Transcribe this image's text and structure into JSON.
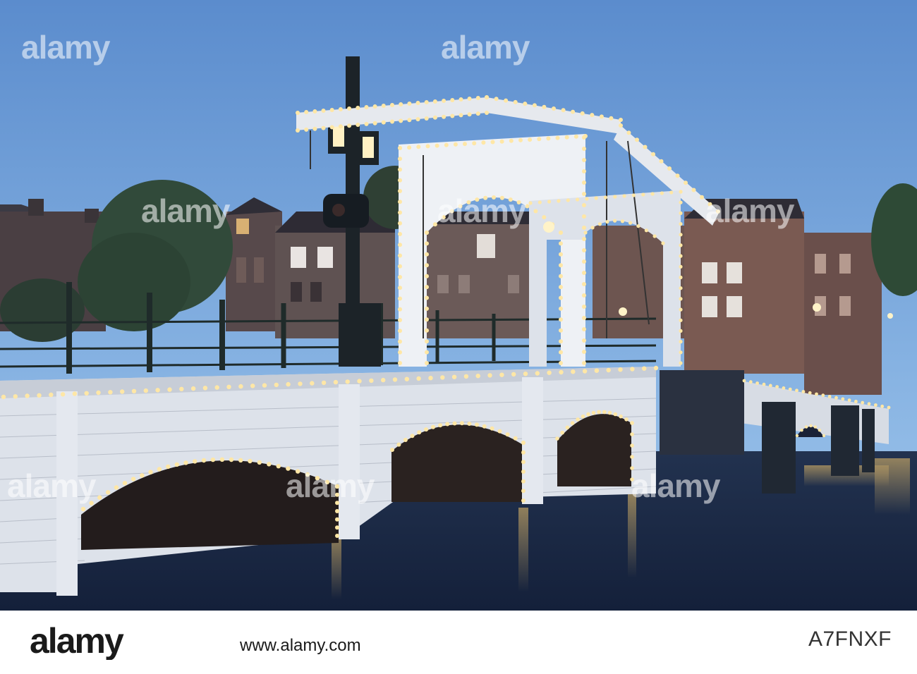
{
  "watermark": {
    "brand": "alamy",
    "positions": [
      "top-left-row",
      "top-right-row",
      "mid-left-row",
      "mid-right-row",
      "lower-left-row",
      "lower-right-row"
    ]
  },
  "footer": {
    "logo_text": "alamy",
    "site_text": "www.alamy.com",
    "image_id": "A7FNXF"
  },
  "colors": {
    "sky_top": "#5a8bcd",
    "sky_bottom": "#9ec6ec",
    "bridge_white": "#e8ecf2",
    "light_glow": "#ffd98a",
    "water": "#1d2d4a"
  }
}
